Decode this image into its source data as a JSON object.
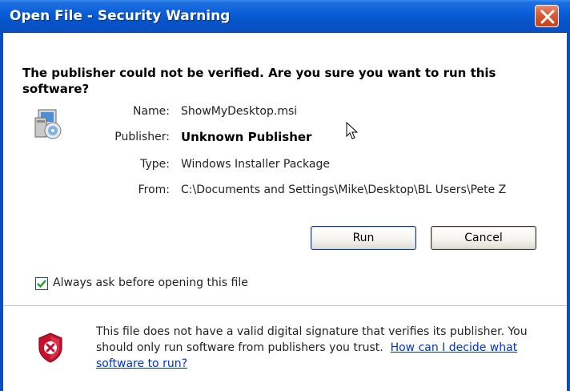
{
  "window": {
    "title": "Open File - Security Warning"
  },
  "dialog": {
    "heading": "The publisher could not be verified.  Are you sure you want to run this software?",
    "fields": [
      {
        "label": "Name:",
        "value": "ShowMyDesktop.msi"
      },
      {
        "label": "Publisher:",
        "value": "Unknown Publisher"
      },
      {
        "label": "Type:",
        "value": "Windows Installer Package"
      },
      {
        "label": "From:",
        "value": "C:\\Documents and Settings\\Mike\\Desktop\\BL Users\\Pete Z"
      }
    ],
    "run_label": "Run",
    "cancel_label": "Cancel",
    "checkbox_label": "Always ask before opening this file",
    "checkbox_checked": true,
    "warning_text": "This file does not have a valid digital signature that verifies its publisher. You should only run software from publishers you trust.",
    "warning_link": "How can I decide what software to run?"
  },
  "icons": {
    "close": "close-icon",
    "installer": "installer-package-icon",
    "cursor": "mouse-cursor-icon",
    "shield": "security-shield-icon",
    "check": "checkmark-icon"
  },
  "colors": {
    "titlebar": "#0a5fd8",
    "close_button": "#d65a36",
    "link": "#0033cc",
    "shield_red": "#c8102e"
  }
}
